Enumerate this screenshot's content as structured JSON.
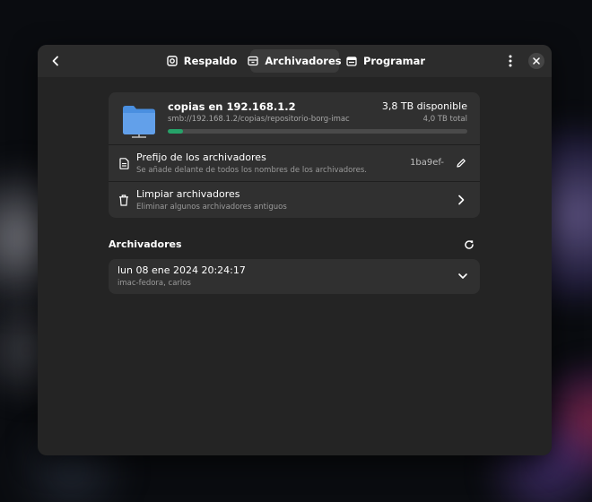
{
  "window": {
    "tabs": [
      {
        "label": "Respaldo",
        "icon": "backup-icon",
        "active": false
      },
      {
        "label": "Archivadores",
        "icon": "archives-icon",
        "active": true
      },
      {
        "label": "Programar",
        "icon": "calendar-icon",
        "active": false
      }
    ]
  },
  "repository": {
    "title": "copias en 192.168.1.2",
    "url": "smb://192.168.1.2/copias/repositorio-borg-imac",
    "available": "3,8 TB disponible",
    "total": "4,0 TB total",
    "usage_fraction": 0.05,
    "accent_color": "#26a269",
    "icon": "folder-icon"
  },
  "prefix_row": {
    "title": "Prefijo de los archivadores",
    "subtitle": "Se añade delante de todos los nombres de los archivadores.",
    "value": "1ba9ef-",
    "icon": "document-icon",
    "action_icon": "pencil-icon"
  },
  "cleanup_row": {
    "title": "Limpiar archivadores",
    "subtitle": "Eliminar algunos archivadores antiguos",
    "icon": "trash-icon",
    "action_icon": "chevron-right-icon"
  },
  "archives_section": {
    "title": "Archivadores",
    "items": [
      {
        "date": "lun 08 ene 2024 20:24:17",
        "meta": "imac-fedora, carlos"
      }
    ]
  }
}
